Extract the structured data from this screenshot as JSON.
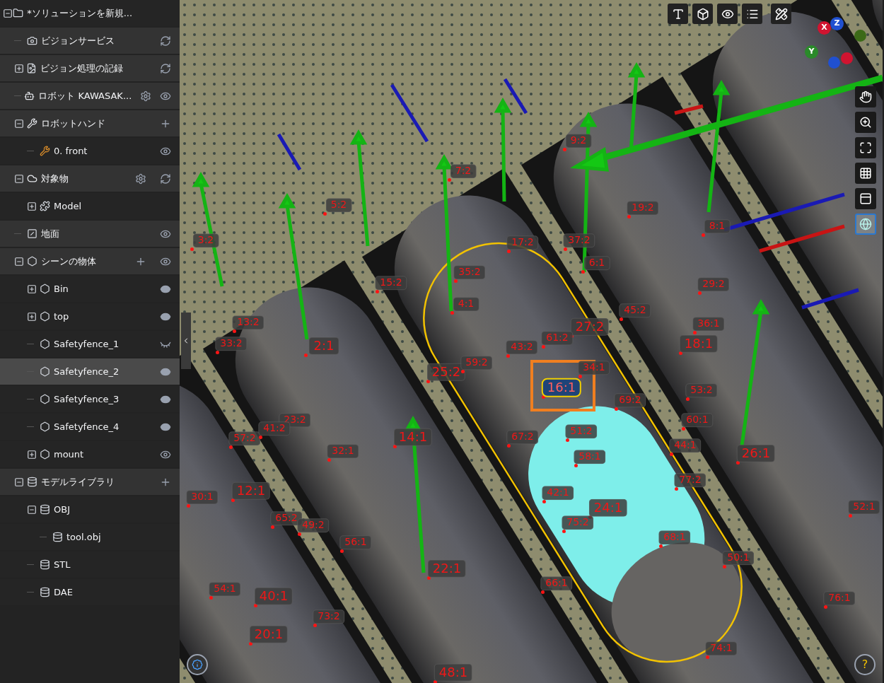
{
  "tree": {
    "label": "*ソリューションを新規...",
    "expanded": true,
    "selected": false,
    "children": [
      {
        "label": "ビジョンサービス",
        "selected": false
      },
      {
        "label": "ビジョン処理の記録",
        "expanded": false,
        "selected": false
      },
      {
        "label": "ロボット KAWASAK...",
        "selected": false,
        "visible": true
      },
      {
        "label": "ロボットハンド",
        "expanded": true,
        "selected": false,
        "children": [
          {
            "label": "0. front",
            "selected": false,
            "visible": true
          }
        ]
      },
      {
        "label": "対象物",
        "expanded": true,
        "selected": false,
        "children": [
          {
            "label": "Model",
            "expanded": false,
            "selected": false
          }
        ]
      },
      {
        "label": "地面",
        "selected": false,
        "visible": true
      },
      {
        "label": "シーンの物体",
        "expanded": true,
        "selected": false,
        "visible": true,
        "children": [
          {
            "label": "Bin",
            "expanded": false,
            "selected": false,
            "visible": true
          },
          {
            "label": "top",
            "expanded": false,
            "selected": false,
            "visible": true
          },
          {
            "label": "Safetyfence_1",
            "selected": false,
            "visible": false
          },
          {
            "label": "Safetyfence_2",
            "selected": true,
            "visible": true
          },
          {
            "label": "Safetyfence_3",
            "selected": false,
            "visible": true
          },
          {
            "label": "Safetyfence_4",
            "selected": false,
            "visible": true
          },
          {
            "label": "mount",
            "expanded": false,
            "selected": false,
            "visible": true
          }
        ]
      },
      {
        "label": "モデルライブラリ",
        "expanded": true,
        "selected": false,
        "children": [
          {
            "label": "OBJ",
            "expanded": true,
            "selected": false,
            "children": [
              {
                "label": "tool.obj",
                "selected": false
              }
            ]
          },
          {
            "label": "STL",
            "selected": false
          },
          {
            "label": "DAE",
            "selected": false
          }
        ]
      }
    ]
  },
  "view_tools": [
    {
      "selected": false
    },
    {
      "selected": false
    },
    {
      "selected": false
    },
    {
      "selected": false
    },
    {
      "selected": false
    },
    {
      "selected": true
    }
  ],
  "axis_gizmo": {
    "labels": [
      "X",
      "Z",
      "Y"
    ]
  },
  "point_labels": [
    {
      "text": "9:2",
      "selected": false
    },
    {
      "text": "7:2",
      "selected": false
    },
    {
      "text": "5:2",
      "selected": false
    },
    {
      "text": "19:2",
      "selected": false
    },
    {
      "text": "8:1",
      "selected": false
    },
    {
      "text": "3:2",
      "selected": false
    },
    {
      "text": "17:2",
      "selected": false
    },
    {
      "text": "37:2",
      "selected": false
    },
    {
      "text": "6:1",
      "selected": false
    },
    {
      "text": "35:2",
      "selected": false
    },
    {
      "text": "15:2",
      "selected": false
    },
    {
      "text": "29:2",
      "selected": false
    },
    {
      "text": "4:1",
      "selected": false
    },
    {
      "text": "45:2",
      "selected": false
    },
    {
      "text": "13:2",
      "selected": false
    },
    {
      "text": "27:2",
      "selected": false
    },
    {
      "text": "36:1",
      "selected": false
    },
    {
      "text": "33:2",
      "selected": false
    },
    {
      "text": "2:1",
      "selected": false
    },
    {
      "text": "43:2",
      "selected": false
    },
    {
      "text": "61:2",
      "selected": false
    },
    {
      "text": "18:1",
      "selected": false
    },
    {
      "text": "25:2",
      "selected": false
    },
    {
      "text": "59:2",
      "selected": false
    },
    {
      "text": "34:1",
      "selected": false
    },
    {
      "text": "16:1",
      "selected": true
    },
    {
      "text": "53:2",
      "selected": false
    },
    {
      "text": "69:2",
      "selected": false
    },
    {
      "text": "23:2",
      "selected": false
    },
    {
      "text": "60:1",
      "selected": false
    },
    {
      "text": "57:2",
      "selected": false
    },
    {
      "text": "41:2",
      "selected": false
    },
    {
      "text": "14:1",
      "selected": false
    },
    {
      "text": "67:2",
      "selected": false
    },
    {
      "text": "51:2",
      "selected": false
    },
    {
      "text": "32:1",
      "selected": false
    },
    {
      "text": "58:1",
      "selected": false
    },
    {
      "text": "44:1",
      "selected": false
    },
    {
      "text": "26:1",
      "selected": false
    },
    {
      "text": "77:2",
      "selected": false
    },
    {
      "text": "30:1",
      "selected": false
    },
    {
      "text": "12:1",
      "selected": false
    },
    {
      "text": "42:1",
      "selected": false
    },
    {
      "text": "24:1",
      "selected": false
    },
    {
      "text": "52:1",
      "selected": false
    },
    {
      "text": "65:2",
      "selected": false
    },
    {
      "text": "49:2",
      "selected": false
    },
    {
      "text": "75:2",
      "selected": false
    },
    {
      "text": "56:1",
      "selected": false
    },
    {
      "text": "68:1",
      "selected": false
    },
    {
      "text": "50:1",
      "selected": false
    },
    {
      "text": "22:1",
      "selected": false
    },
    {
      "text": "54:1",
      "selected": false
    },
    {
      "text": "40:1",
      "selected": false
    },
    {
      "text": "66:1",
      "selected": false
    },
    {
      "text": "76:1",
      "selected": false
    },
    {
      "text": "73:2",
      "selected": false
    },
    {
      "text": "20:1",
      "selected": false
    },
    {
      "text": "74:1",
      "selected": false
    },
    {
      "text": "48:1",
      "selected": false
    }
  ],
  "help_button": "?"
}
